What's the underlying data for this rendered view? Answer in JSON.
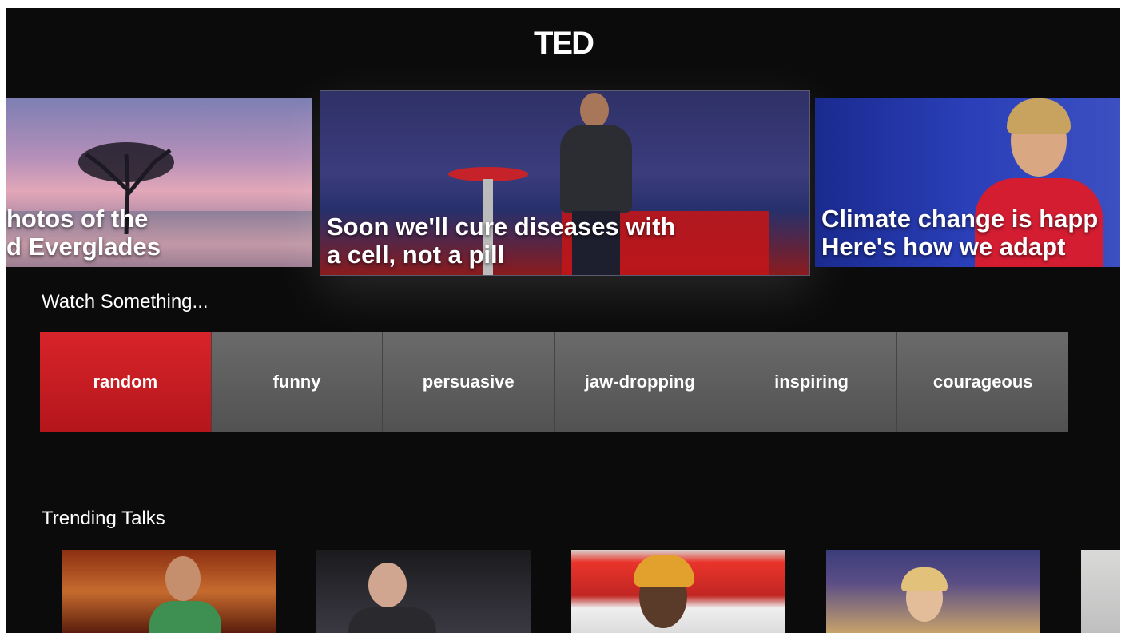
{
  "app": {
    "logo": "TED"
  },
  "hero": {
    "cards": [
      {
        "caption_line1": "hotos of the",
        "caption_line2": "d Everglades"
      },
      {
        "caption_line1": "Soon we'll cure diseases with",
        "caption_line2": "a cell, not a pill"
      },
      {
        "caption_line1": "Climate change is happ",
        "caption_line2": "Here's how we adapt"
      }
    ]
  },
  "watch": {
    "label": "Watch Something...",
    "moods": [
      "random",
      "funny",
      "persuasive",
      "jaw-dropping",
      "inspiring",
      "courageous"
    ],
    "selected": "random"
  },
  "trending": {
    "label": "Trending Talks"
  },
  "colors": {
    "accent": "#c8181e",
    "background": "#0b0b0b",
    "tile": "#5c5c5c"
  }
}
